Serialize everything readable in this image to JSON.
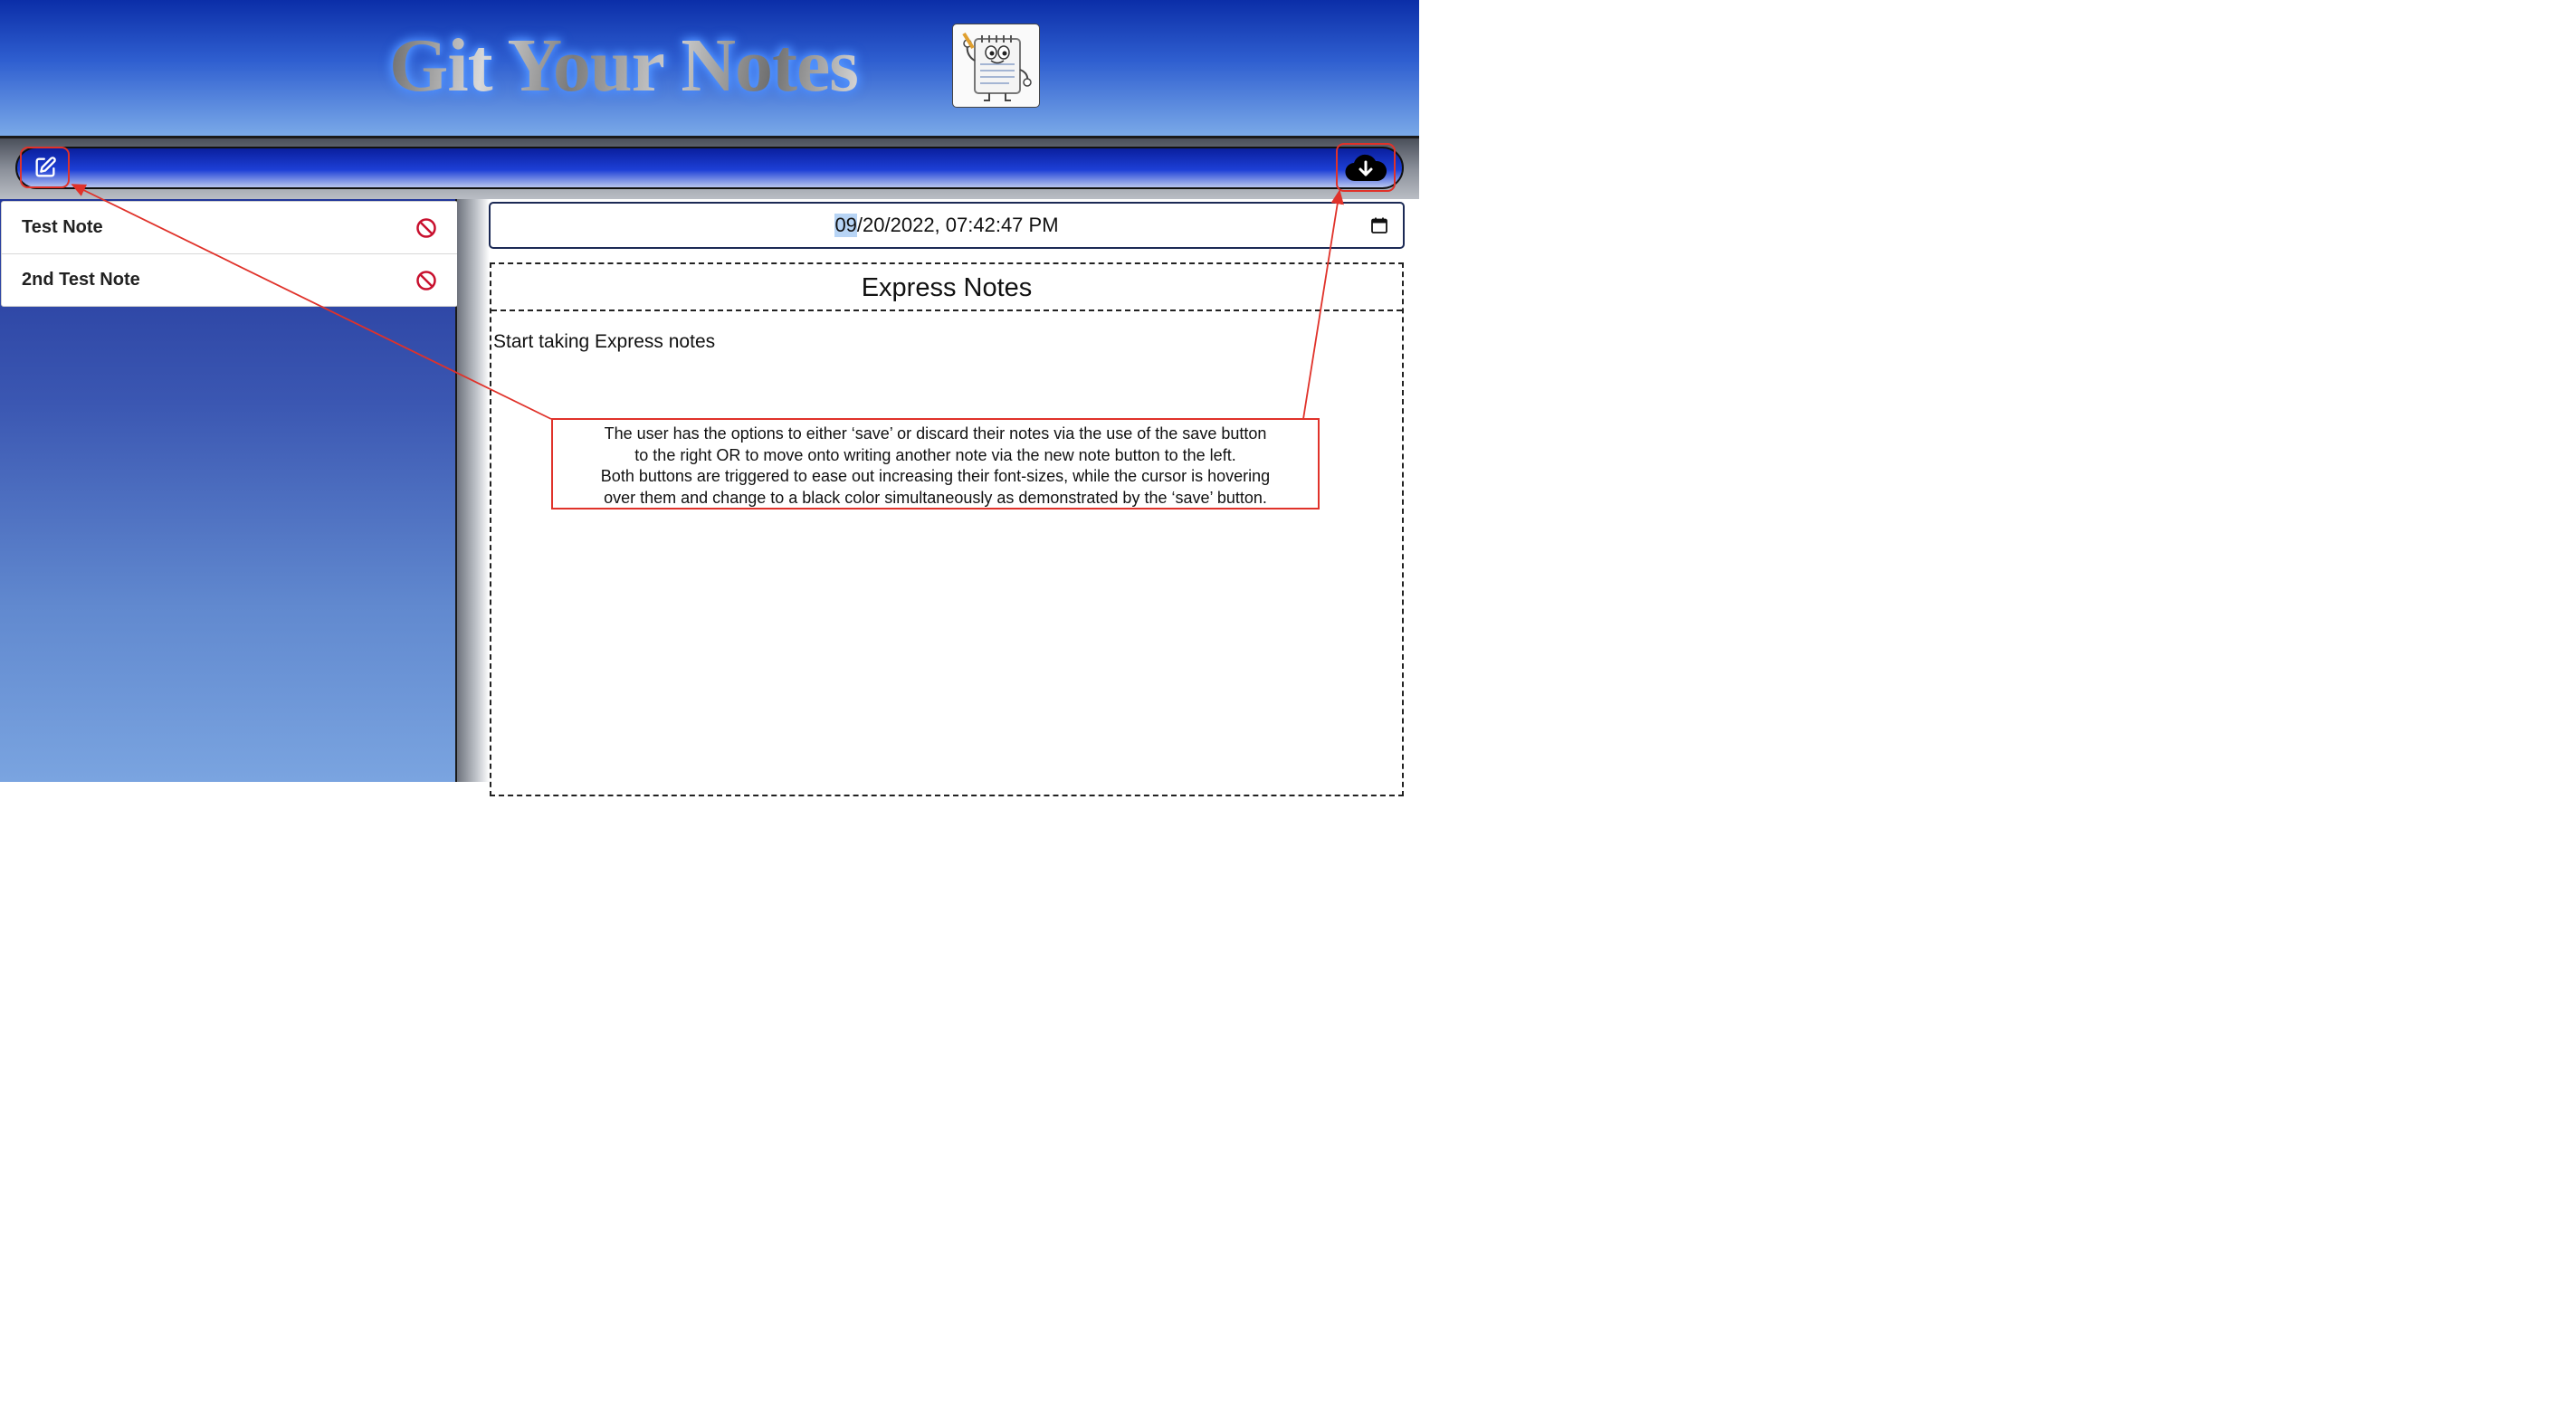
{
  "header": {
    "title": "Git Your Notes",
    "logo_icon": "notepad-mascot-icon"
  },
  "toolbar": {
    "new_note_icon": "pencil-square-icon",
    "save_icon": "cloud-download-icon"
  },
  "sidebar": {
    "notes": [
      {
        "title": "Test Note",
        "delete_icon": "prohibited-icon"
      },
      {
        "title": "2nd Test Note",
        "delete_icon": "prohibited-icon"
      }
    ]
  },
  "main": {
    "date": {
      "selected_part": "09",
      "rest": "/20/2022, 07:42:47 PM",
      "icon": "calendar-icon"
    },
    "notes_title": "Express Notes",
    "notes_placeholder": "Start taking Express notes"
  },
  "annotation": {
    "lines": [
      "The user has the options to either ‘save’ or discard their notes via the use of the save button",
      "to the right OR to move onto writing another note via the new note button to the left.",
      "Both buttons are triggered to ease out increasing their font-sizes, while the cursor is hovering",
      "over them and change to a black color simultaneously as demonstrated by the ‘save’ button."
    ]
  },
  "colors": {
    "header_top": "#0b2ea8",
    "header_bottom": "#7aa9e8",
    "annotation_red": "#e0322a",
    "delete_red": "#c8102e",
    "title_glow": "#5fa2ff"
  }
}
